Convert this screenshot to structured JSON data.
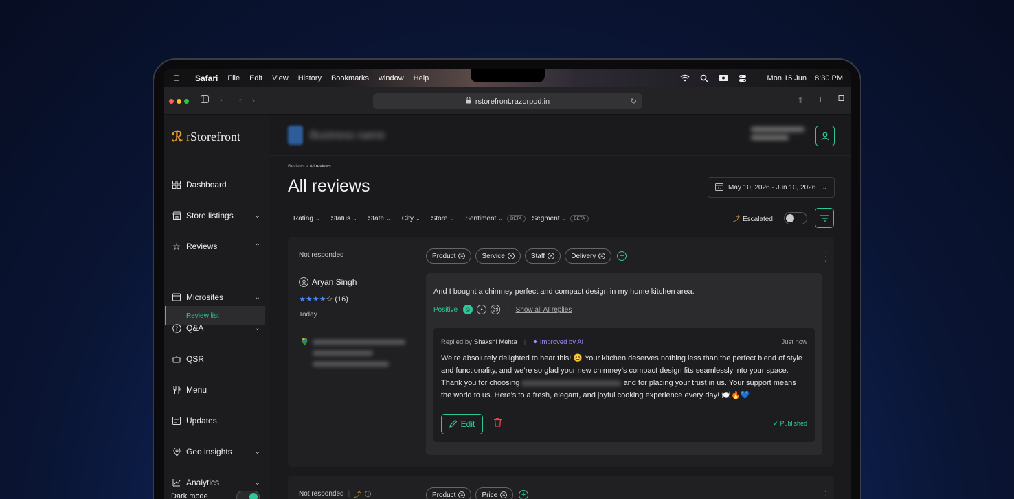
{
  "menubar": {
    "app": "Safari",
    "items": [
      "File",
      "Edit",
      "View",
      "History",
      "Bookmarks",
      "window",
      "Help"
    ],
    "date": "Mon 15 Jun",
    "time": "8:30 PM"
  },
  "browser": {
    "url": "rstorefront.razorpod.in"
  },
  "brand": {
    "prefix": "r",
    "name": "Storefront",
    "accent": "#e89a2b",
    "primary": "#2ec79a"
  },
  "sidebar": {
    "items": [
      {
        "label": "Dashboard",
        "icon": "grid-icon"
      },
      {
        "label": "Store listings",
        "icon": "store-icon"
      },
      {
        "label": "Reviews",
        "icon": "star-icon"
      },
      {
        "label": "Microsites",
        "icon": "browser-icon"
      },
      {
        "label": "Q&A",
        "icon": "question-icon"
      },
      {
        "label": "QSR",
        "icon": "pot-icon"
      },
      {
        "label": "Menu",
        "icon": "cutlery-icon"
      },
      {
        "label": "Updates",
        "icon": "newspaper-icon"
      },
      {
        "label": "Geo insights",
        "icon": "pin-icon"
      },
      {
        "label": "Analytics",
        "icon": "chart-icon"
      }
    ],
    "subitem": "Review list",
    "dark_mode_label": "Dark mode"
  },
  "page": {
    "breadcrumb_root": "Reviews",
    "breadcrumb_current": "All reviews",
    "title": "All reviews",
    "date_range": "May 10, 2026 - Jun 10, 2026"
  },
  "filters": {
    "items": [
      "Rating",
      "Status",
      "State",
      "City",
      "Store",
      "Sentiment",
      "Segment"
    ],
    "beta": "BETA",
    "escalated": "Escalated"
  },
  "review1": {
    "status": "Not responded",
    "reviewer": "Aryan Singh",
    "rating": 4,
    "rating_count": "(16)",
    "time": "Today",
    "tags": [
      "Product",
      "Service",
      "Staff",
      "Delivery"
    ],
    "text": "And I bought a chimney perfect and compact design in my home kitchen area.",
    "sentiment": "Positive",
    "show_ai": "Show all AI replies",
    "reply": {
      "replied_by_label": "Replied by",
      "replied_by": "Shakshi Mehta",
      "ai_label": "Improved by AI",
      "time": "Just now",
      "text_part1": "We’re absolutely delighted to hear this! 😊 Your kitchen deserves nothing less than the perfect blend of style and functionality, and we’re so glad your new chimney’s compact design fits seamlessly into your space. Thank you for choosing",
      "text_part2": "and for placing your trust in us. Your support means the world to us. Here’s to a fresh, elegant, and joyful cooking experience every day! 🍽️🔥💙",
      "edit_label": "Edit",
      "published": "Published"
    }
  },
  "review2": {
    "status": "Not responded",
    "tags": [
      "Product",
      "Price"
    ]
  }
}
